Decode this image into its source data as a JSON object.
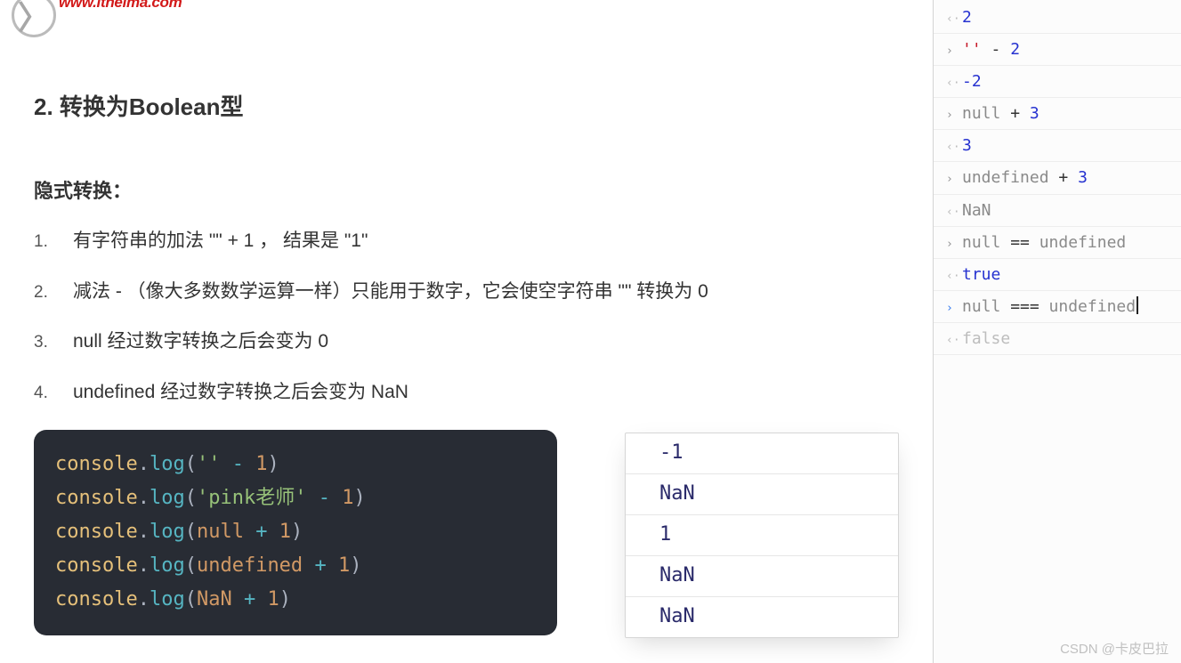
{
  "logo": {
    "text": "www.itneima.com"
  },
  "section_title": "2. 转换为Boolean型",
  "sub_title": "隐式转换：",
  "list": [
    "有字符串的加法  \"\"  + 1 ， 结果是  \"1\"",
    "减法 - （像大多数数学运算一样）只能用于数字，它会使空字符串 \"\" 转换为 0",
    "null 经过数字转换之后会变为 0",
    "undefined 经过数字转换之后会变为 NaN"
  ],
  "code": {
    "lines": [
      {
        "obj": "console",
        "fn": "log",
        "arg_tokens": [
          {
            "t": "str",
            "v": "''"
          },
          {
            "t": "txt",
            "v": " "
          },
          {
            "t": "op",
            "v": "-"
          },
          {
            "t": "txt",
            "v": " "
          },
          {
            "t": "num",
            "v": "1"
          }
        ]
      },
      {
        "obj": "console",
        "fn": "log",
        "arg_tokens": [
          {
            "t": "str",
            "v": "'pink老师'"
          },
          {
            "t": "txt",
            "v": " "
          },
          {
            "t": "op",
            "v": "-"
          },
          {
            "t": "txt",
            "v": " "
          },
          {
            "t": "num",
            "v": "1"
          }
        ]
      },
      {
        "obj": "console",
        "fn": "log",
        "arg_tokens": [
          {
            "t": "kw",
            "v": "null"
          },
          {
            "t": "txt",
            "v": " "
          },
          {
            "t": "op",
            "v": "+"
          },
          {
            "t": "txt",
            "v": " "
          },
          {
            "t": "num",
            "v": "1"
          }
        ]
      },
      {
        "obj": "console",
        "fn": "log",
        "arg_tokens": [
          {
            "t": "kw",
            "v": "undefined"
          },
          {
            "t": "txt",
            "v": " "
          },
          {
            "t": "op",
            "v": "+"
          },
          {
            "t": "txt",
            "v": " "
          },
          {
            "t": "num",
            "v": "1"
          }
        ]
      },
      {
        "obj": "console",
        "fn": "log",
        "arg_tokens": [
          {
            "t": "kw",
            "v": "NaN"
          },
          {
            "t": "txt",
            "v": " "
          },
          {
            "t": "op",
            "v": "+"
          },
          {
            "t": "txt",
            "v": " "
          },
          {
            "t": "num",
            "v": "1"
          }
        ]
      }
    ]
  },
  "output": [
    "-1",
    "NaN",
    "1",
    "NaN",
    "NaN"
  ],
  "console": [
    {
      "dir": "out",
      "tokens": [
        {
          "c": "c-num",
          "v": "2"
        }
      ]
    },
    {
      "dir": "in",
      "tokens": [
        {
          "c": "c-str",
          "v": "''"
        },
        {
          "c": "c-op",
          "v": " - "
        },
        {
          "c": "c-num",
          "v": "2"
        }
      ]
    },
    {
      "dir": "out",
      "tokens": [
        {
          "c": "c-num",
          "v": "-2"
        }
      ]
    },
    {
      "dir": "in",
      "tokens": [
        {
          "c": "c-null",
          "v": "null"
        },
        {
          "c": "c-op",
          "v": " + "
        },
        {
          "c": "c-num",
          "v": "3"
        }
      ]
    },
    {
      "dir": "out",
      "tokens": [
        {
          "c": "c-num",
          "v": "3"
        }
      ]
    },
    {
      "dir": "in",
      "tokens": [
        {
          "c": "c-undef",
          "v": "undefined"
        },
        {
          "c": "c-op",
          "v": " + "
        },
        {
          "c": "c-num",
          "v": "3"
        }
      ]
    },
    {
      "dir": "out",
      "tokens": [
        {
          "c": "c-nan",
          "v": "NaN"
        }
      ]
    },
    {
      "dir": "in",
      "tokens": [
        {
          "c": "c-null",
          "v": "null"
        },
        {
          "c": "c-op",
          "v": " == "
        },
        {
          "c": "c-undef",
          "v": "undefined"
        }
      ]
    },
    {
      "dir": "out",
      "tokens": [
        {
          "c": "c-true",
          "v": "true"
        }
      ]
    },
    {
      "dir": "active",
      "tokens": [
        {
          "c": "c-null",
          "v": "null"
        },
        {
          "c": "c-op",
          "v": " === "
        },
        {
          "c": "c-undef",
          "v": "undefined"
        }
      ],
      "cursor": true
    },
    {
      "dir": "out-dim",
      "tokens": [
        {
          "c": "c-false",
          "v": "false"
        }
      ]
    }
  ],
  "watermark": "CSDN @卡皮巴拉"
}
